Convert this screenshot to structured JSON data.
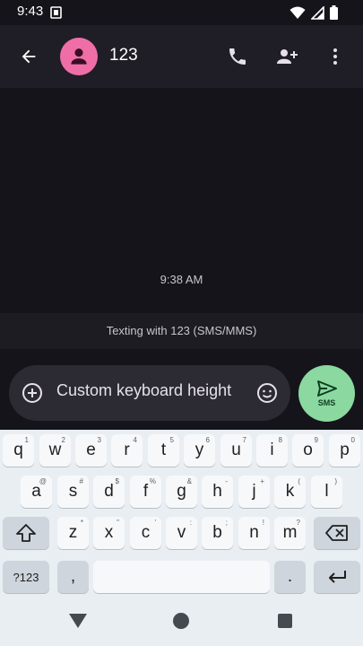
{
  "status_bar": {
    "time": "9:43"
  },
  "header": {
    "contact_name": "123"
  },
  "conversation": {
    "timestamp": "9:38 AM"
  },
  "banner": {
    "text": "Texting with 123 (SMS/MMS)"
  },
  "compose": {
    "text": "Custom keyboard height",
    "send_label": "SMS"
  },
  "keyboard": {
    "row1": [
      {
        "key": "q",
        "hint": "1"
      },
      {
        "key": "w",
        "hint": "2"
      },
      {
        "key": "e",
        "hint": "3"
      },
      {
        "key": "r",
        "hint": "4"
      },
      {
        "key": "t",
        "hint": "5"
      },
      {
        "key": "y",
        "hint": "6"
      },
      {
        "key": "u",
        "hint": "7"
      },
      {
        "key": "i",
        "hint": "8"
      },
      {
        "key": "o",
        "hint": "9"
      },
      {
        "key": "p",
        "hint": "0"
      }
    ],
    "row2": [
      {
        "key": "a",
        "hint": "@"
      },
      {
        "key": "s",
        "hint": "#"
      },
      {
        "key": "d",
        "hint": "$"
      },
      {
        "key": "f",
        "hint": "%"
      },
      {
        "key": "g",
        "hint": "&"
      },
      {
        "key": "h",
        "hint": "-"
      },
      {
        "key": "j",
        "hint": "+"
      },
      {
        "key": "k",
        "hint": "("
      },
      {
        "key": "l",
        "hint": ")"
      }
    ],
    "row3": [
      {
        "key": "z",
        "hint": "*"
      },
      {
        "key": "x",
        "hint": "\""
      },
      {
        "key": "c",
        "hint": "'"
      },
      {
        "key": "v",
        "hint": ":"
      },
      {
        "key": "b",
        "hint": ";"
      },
      {
        "key": "n",
        "hint": "!"
      },
      {
        "key": "m",
        "hint": "?"
      }
    ],
    "symbols_key": "?123",
    "comma_key": ",",
    "period_key": "."
  },
  "colors": {
    "avatar": "#f06ea8",
    "send_button": "#8bd9a0",
    "app_bar": "#1f1e26",
    "background": "#15141b"
  }
}
